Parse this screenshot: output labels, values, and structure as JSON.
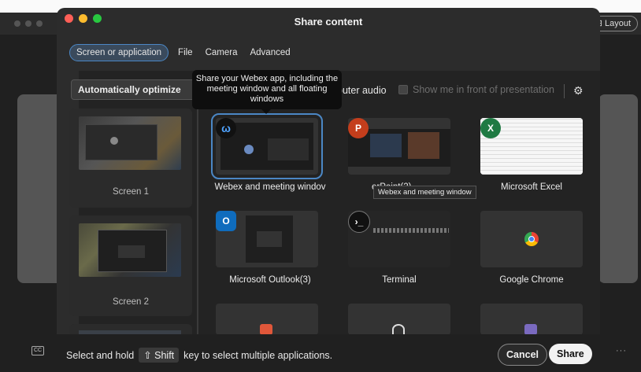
{
  "background": {
    "layout_label": "Layout"
  },
  "dialog": {
    "title": "Share content",
    "tabs": [
      {
        "label": "Screen or application"
      },
      {
        "label": "File"
      },
      {
        "label": "Camera"
      },
      {
        "label": "Advanced"
      }
    ],
    "optimize_label": "Automatically optimize",
    "audio_label": "puter audio",
    "show_me_label": "Show me in front of presentation",
    "tooltip": "Share your Webex app, including the meeting window and all floating windows",
    "hover_tooltip": "Webex and meeting window",
    "screens": [
      {
        "label": "Screen 1"
      },
      {
        "label": "Screen 2"
      }
    ],
    "apps": [
      {
        "label": "Webex and meeting windov",
        "icon": "webex-icon"
      },
      {
        "label": "erPoint(2)",
        "icon": "powerpoint-icon"
      },
      {
        "label": "Microsoft Excel",
        "icon": "excel-icon"
      },
      {
        "label": "Microsoft Outlook(3)",
        "icon": "outlook-icon"
      },
      {
        "label": "Terminal",
        "icon": "terminal-icon"
      },
      {
        "label": "Google Chrome",
        "icon": "chrome-icon"
      }
    ]
  },
  "bottom": {
    "hint_before": "Select and hold",
    "key": "⇧ Shift",
    "hint_after": "key to select multiple applications.",
    "cancel_label": "Cancel",
    "share_label": "Share",
    "more_label": "···"
  },
  "colors": {
    "accent": "#4b87c5",
    "share_bg": "#f2f2f2"
  }
}
